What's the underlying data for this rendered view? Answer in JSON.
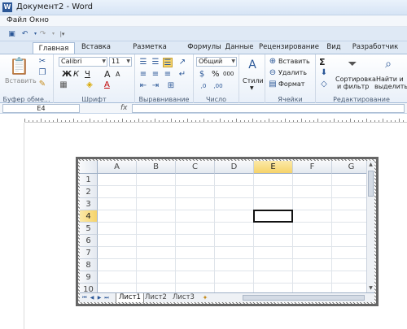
{
  "window": {
    "title": "Документ2 - Word"
  },
  "menu": [
    "Файл",
    "Окно"
  ],
  "qat": {
    "save_icon": "save-icon",
    "undo_icon": "undo-icon",
    "redo_icon": "redo-icon"
  },
  "tabs": [
    "Главная",
    "Вставка",
    "Разметка страницы",
    "Формулы",
    "Данные",
    "Рецензирование",
    "Вид",
    "Разработчик"
  ],
  "ribbon": {
    "clipboard": {
      "paste": "Вставить",
      "label": "Буфер обме..."
    },
    "font": {
      "name": "Calibri",
      "size": "11",
      "bold": "Ж",
      "italic": "К",
      "underline": "Ч",
      "grow": "A",
      "shrink": "A",
      "color_letter": "A",
      "label": "Шрифт"
    },
    "alignment": {
      "label": "Выравнивание"
    },
    "number": {
      "format": "Общий",
      "percent": "%",
      "thousands": "000",
      "label": "Число"
    },
    "styles": {
      "label": "Стили"
    },
    "cells": {
      "insert": "Вставить",
      "delete": "Удалить",
      "format": "Формат",
      "label": "Ячейки"
    },
    "editing": {
      "sort": "Сортировка",
      "sort2": "и фильтр",
      "find": "Найти и",
      "find2": "выделить",
      "label": "Редактирование",
      "sigma": "Σ"
    }
  },
  "formula_bar": {
    "name_box": "E4",
    "fx": "fx",
    "content": ""
  },
  "sheet": {
    "columns": [
      "A",
      "B",
      "C",
      "D",
      "E",
      "F",
      "G"
    ],
    "rows": [
      "1",
      "2",
      "3",
      "4",
      "5",
      "6",
      "7",
      "8",
      "9",
      "10"
    ],
    "active_cell": "E4",
    "tabs": [
      "Лист1",
      "Лист2",
      "Лист3"
    ],
    "active_tab": "Лист1"
  },
  "colors": {
    "accent": "#2b5797",
    "ribbon_bg": "#e9f0f9",
    "selection": "#f6d36a"
  }
}
